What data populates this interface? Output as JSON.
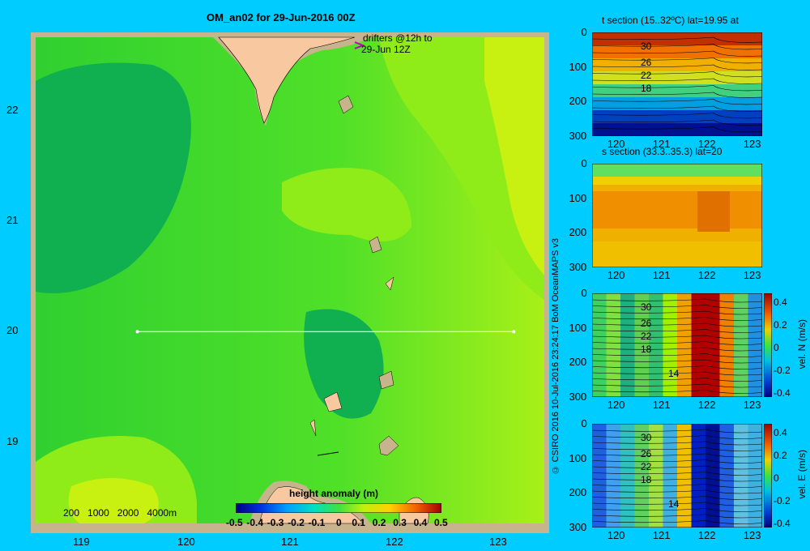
{
  "main_map": {
    "title": "OM_an02 for 29-Jun-2016 00Z",
    "drifters_label_1": "drifters @12h to",
    "drifters_label_2": "29-Jun 12Z",
    "lon_ticks": [
      "119",
      "120",
      "121",
      "122",
      "123"
    ],
    "lat_ticks": [
      "22",
      "21",
      "20",
      "19"
    ],
    "depth_legend": [
      "200",
      "1000",
      "2000",
      "4000m"
    ],
    "colorbar_title": "height anomaly  (m)",
    "colorbar_ticks": [
      "-0.5",
      "-0.4",
      "-0.3",
      "-0.2",
      "-0.1",
      "0",
      "0.1",
      "0.2",
      "0.3",
      "0.4",
      "0.5"
    ],
    "section_line": {
      "lon_start": 119.5,
      "lon_end": 123.2,
      "lat": 20.0
    }
  },
  "credit": "© CSIRO 2016   10-Jul-2016 23:24:17 BoM OceanMAPS v3",
  "panels": [
    {
      "title": "t section (15..32ºC) lat=19.95 at",
      "depth_ticks": [
        "0",
        "100",
        "200",
        "300"
      ],
      "lon_ticks": [
        "120",
        "121",
        "122",
        "123"
      ],
      "contour_labels": [
        "30",
        "26",
        "22",
        "18"
      ]
    },
    {
      "title": "s section (33.3..35.3) lat=20",
      "depth_ticks": [
        "0",
        "100",
        "200",
        "300"
      ],
      "lon_ticks": [
        "120",
        "121",
        "122",
        "123"
      ]
    },
    {
      "depth_ticks": [
        "0",
        "100",
        "200",
        "300"
      ],
      "lon_ticks": [
        "120",
        "121",
        "122",
        "123"
      ],
      "contour_labels": [
        "30",
        "26",
        "22",
        "18",
        "14"
      ],
      "colorbar_ticks": [
        "0.4",
        "0.2",
        "0",
        "-0.2",
        "-0.4"
      ],
      "colorbar_label": "vel. N (m/s)"
    },
    {
      "depth_ticks": [
        "0",
        "100",
        "200",
        "300"
      ],
      "lon_ticks": [
        "120",
        "121",
        "122",
        "123"
      ],
      "contour_labels": [
        "30",
        "26",
        "22",
        "18",
        "14"
      ],
      "colorbar_ticks": [
        "0.4",
        "0.2",
        "0",
        "-0.2",
        "-0.4"
      ],
      "colorbar_label": "vel. E (m/s)"
    }
  ],
  "colors": {
    "background": "#00ccff",
    "land": "#f8c8a0",
    "frame": "#c8b48c",
    "green_dark": "#10b050",
    "green_mid": "#30d030",
    "green_light": "#60e820",
    "yellow_green": "#c0f010"
  }
}
